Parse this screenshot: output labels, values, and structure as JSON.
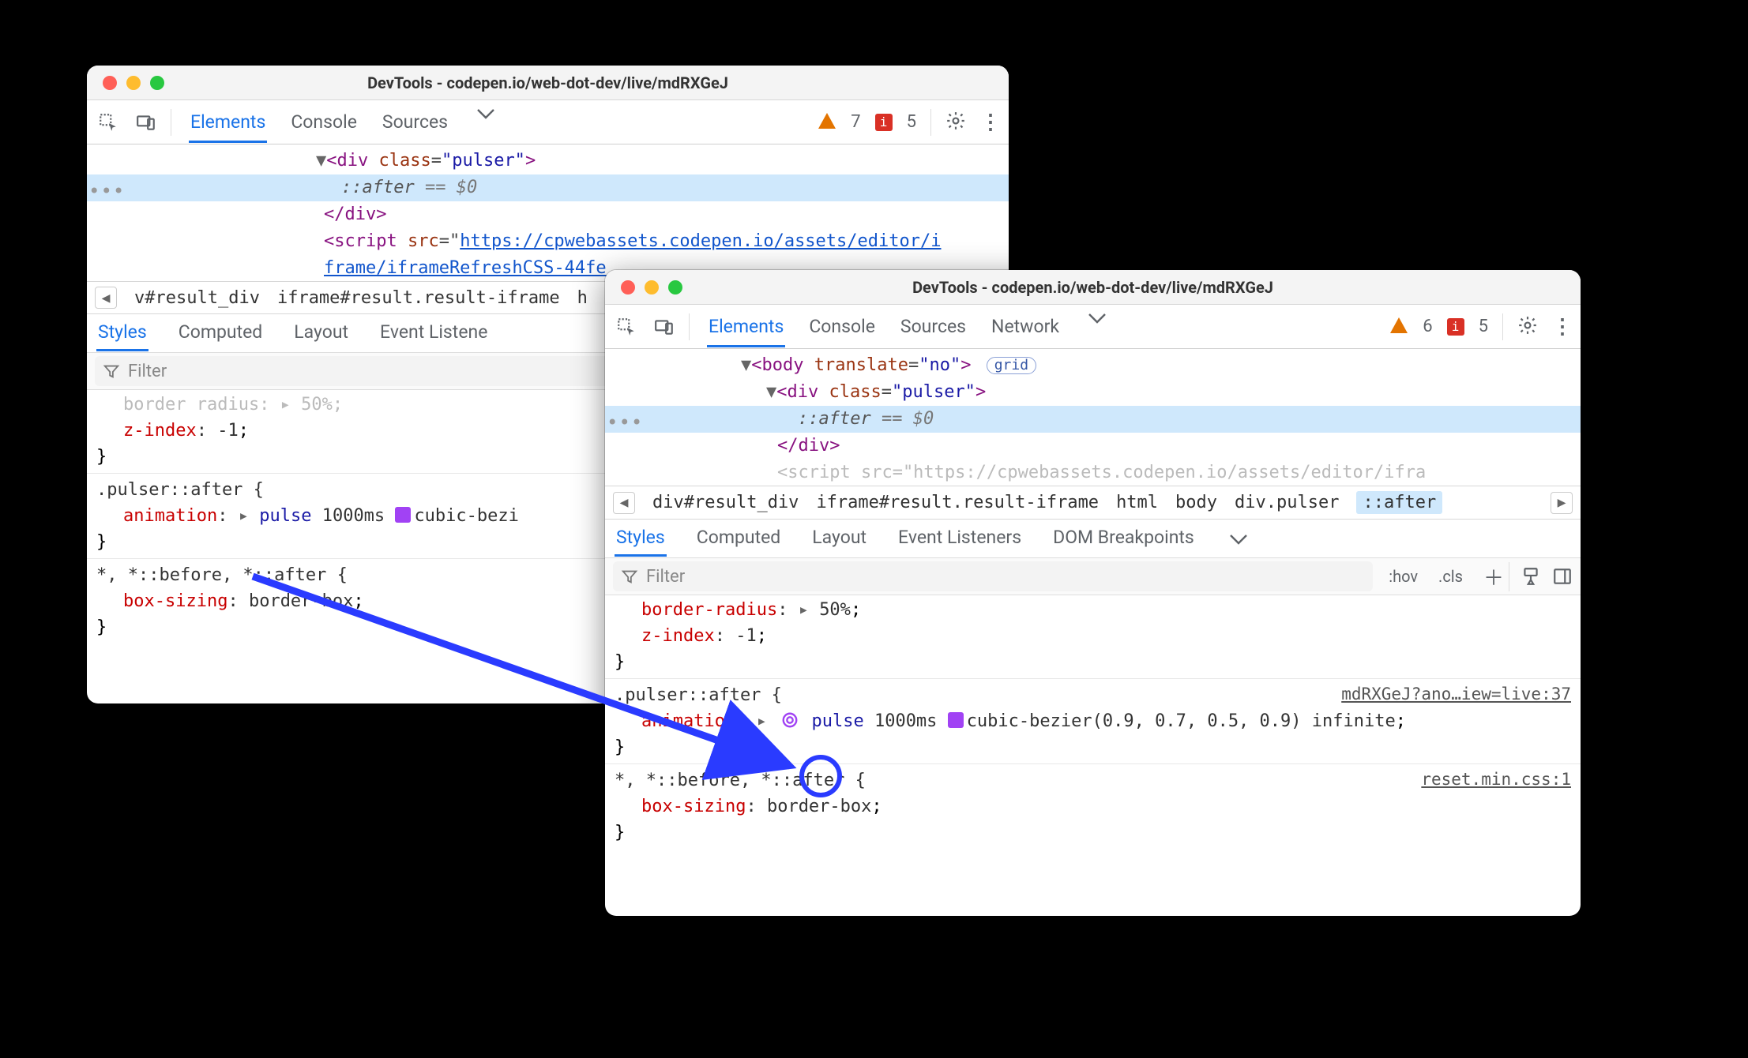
{
  "win1": {
    "title": "DevTools - codepen.io/web-dot-dev/live/mdRXGeJ",
    "toolbar": {
      "tabs": {
        "elements": "Elements",
        "console": "Console",
        "sources": "Sources"
      },
      "warn_count": "7",
      "err_count": "5"
    },
    "dom": {
      "div_open_pre": "<div ",
      "class_attr": "class",
      "class_val": "\"pulser\"",
      "div_open_post": ">",
      "after": "::after",
      "eqeq": " == ",
      "dollar": "$0",
      "div_close": "</div>",
      "script_prefix": "<script ",
      "src_attr": "src",
      "src_eqq": "=\"",
      "script_url_1": "https://cpwebassets.codepen.io/assets/editor/i",
      "script_url_2": "frame/iframeRefreshCSS-44fe"
    },
    "breadcrumb": {
      "item1": "v#result_div",
      "item2": "iframe#result.result-iframe",
      "item3_trunc": "h"
    },
    "subtabs": {
      "styles": "Styles",
      "computed": "Computed",
      "layout": "Layout",
      "listeners": "Event Listene"
    },
    "filter_placeholder": "Filter",
    "styles": {
      "cut_line": "border-radius: ▸ 50%;",
      "l1_prop": "z-index",
      "l1_val": "-1",
      "sel2": ".pulser::after {",
      "l2_prop": "animation",
      "l2_name": "pulse",
      "l2_dur": "1000ms",
      "l2_bez": "cubic-bezi",
      "sel3": "*, *::before, *::after {",
      "l3_prop": "box-sizing",
      "l3_val": "border-box"
    }
  },
  "win2": {
    "title": "DevTools - codepen.io/web-dot-dev/live/mdRXGeJ",
    "toolbar": {
      "tabs": {
        "elements": "Elements",
        "console": "Console",
        "sources": "Sources",
        "network": "Network"
      },
      "warn_count": "6",
      "err_count": "5"
    },
    "dom": {
      "body_open_pre": "<body ",
      "translate_attr": "translate",
      "translate_val": "\"no\"",
      "body_open_post": ">",
      "grid_badge": "grid",
      "div_open_pre": "<div ",
      "class_attr": "class",
      "class_val": "\"pulser\"",
      "div_open_post": ">",
      "after": "::after",
      "eqeq": " == ",
      "dollar": "$0",
      "div_close": "</div>",
      "script_cut": "<script src=\"https://cpwebassets.codepen.io/assets/editor/ifra"
    },
    "breadcrumb": {
      "i1": "div#result_div",
      "i2": "iframe#result.result-iframe",
      "i3": "html",
      "i4": "body",
      "i5": "div.pulser",
      "i6": "::after"
    },
    "subtabs": {
      "styles": "Styles",
      "computed": "Computed",
      "layout": "Layout",
      "listeners": "Event Listeners",
      "dombp": "DOM Breakpoints"
    },
    "filter_placeholder": "Filter",
    "filter_btns": {
      "hov": ":hov",
      "cls": ".cls"
    },
    "styles": {
      "l0_prop": "border-radius",
      "l0_val": "50%",
      "l1_prop": "z-index",
      "l1_val": "-1",
      "src2": "mdRXGeJ?ano…iew=live:37",
      "sel2": ".pulser::after {",
      "l2_prop": "animation",
      "l2_name": "pulse",
      "l2_dur": "1000ms",
      "l2_bez": "cubic-bezier(0.9, 0.7, 0.5, 0.9)",
      "l2_inf": "infinite",
      "src3": "reset.min.css:1",
      "sel3": "*, *::before, *::after {",
      "l3_prop": "box-sizing",
      "l3_val": "border-box"
    }
  }
}
